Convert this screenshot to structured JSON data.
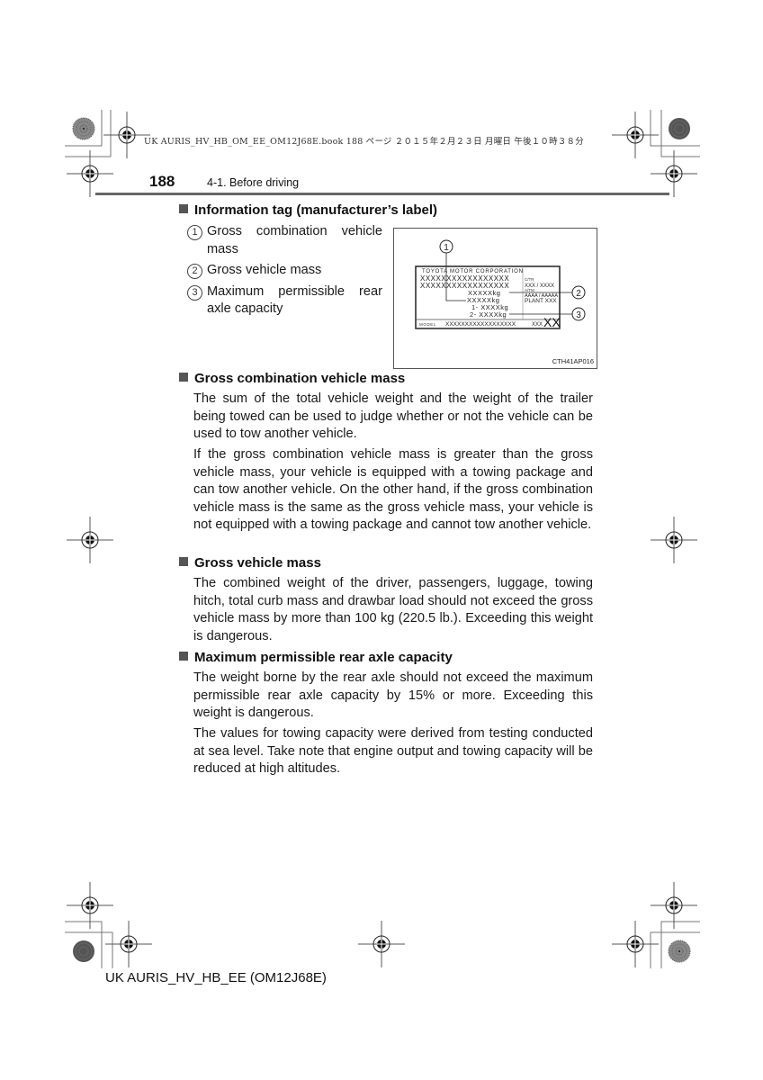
{
  "file_header": "UK AURIS_HV_HB_OM_EE_OM12J68E.book  188 ページ  ２０１５年２月２３日  月曜日  午後１０時３８分",
  "page": {
    "number": "188",
    "section": "4-1. Before driving"
  },
  "info_tag": {
    "heading": "Information tag (manufacturer’s label)",
    "items": [
      {
        "num": "1",
        "text": "Gross combination vehicle mass"
      },
      {
        "num": "2",
        "text": "Gross vehicle mass"
      },
      {
        "num": "3",
        "text": "Maximum permissible rear axle capacity"
      }
    ],
    "figure": {
      "label_title": "TOYOTA MOTOR CORPORATION",
      "row1": "XXXXXXXXXXXXXXXXX",
      "row2": "XXXXXXXXXXXXXXXXX",
      "gcvm": "XXXXXkg",
      "gvm": "XXXXXkg",
      "axle1": "1- XXXXkg",
      "axle2": "2- XXXXkg",
      "ctr_label": "C/TR",
      "ctr_value": "XXX / XXXX",
      "atm_label": "A/TM",
      "atm_value": "AAAA / AAAAA",
      "plant": "PLANT XXX",
      "model_label": "MODEL",
      "model_value": "XXXXXXXXXXXXXXXXXX",
      "small_code": "XXX",
      "big_code": "XX",
      "callouts": [
        "1",
        "2",
        "3"
      ],
      "code": "CTH41AP016"
    }
  },
  "sections": [
    {
      "heading": "Gross combination vehicle mass",
      "paragraphs": [
        "The sum of the total vehicle weight and the weight of the trailer being towed can be used to judge whether or not the vehicle can be used to tow another vehicle.",
        "If the gross combination vehicle mass is greater than the gross vehicle mass, your vehicle is equipped with a towing package and can tow another vehicle. On the other hand, if the gross combination vehicle mass is the same as the gross vehicle mass, your vehicle is not equipped with a towing package and cannot tow another vehicle."
      ]
    },
    {
      "heading": "Gross vehicle mass",
      "paragraphs": [
        "The combined weight of the driver, passengers, luggage, towing hitch, total curb mass and drawbar load should not exceed the gross vehicle mass by more than 100 kg (220.5 lb.). Exceeding this weight is dangerous."
      ]
    },
    {
      "heading": "Maximum permissible rear axle capacity",
      "paragraphs": [
        "The weight borne by the rear axle should not exceed the maximum permissible rear axle capacity by 15% or more. Exceeding this weight is dangerous.",
        "The values for towing capacity were derived from testing conducted at sea level. Take note that engine output and towing capacity will be reduced at high altitudes."
      ]
    }
  ],
  "footer": "UK AURIS_HV_HB_EE (OM12J68E)"
}
